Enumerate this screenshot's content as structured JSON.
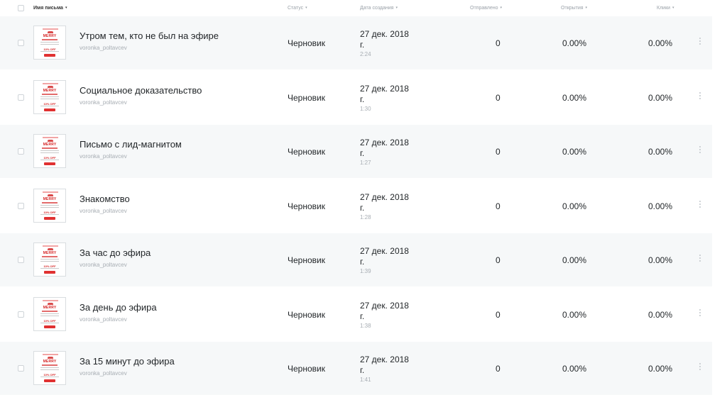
{
  "header": {
    "name": "Имя письма",
    "status": "Статус",
    "created": "Дата создания",
    "sent": "Отправлено",
    "opens": "Открытия",
    "clicks": "Клики"
  },
  "thumbnail": {
    "title": "MERRY",
    "offer": "10% OFF"
  },
  "rows": [
    {
      "name": "Утром тем, кто не был на эфире",
      "sender": "voronka_poltavcev",
      "status": "Черновик",
      "date_line1": "27 дек. 2018",
      "date_line2": "г.",
      "time": "2:24",
      "sent": "0",
      "opens": "0.00%",
      "clicks": "0.00%"
    },
    {
      "name": "Социальное доказательство",
      "sender": "voronka_poltavcev",
      "status": "Черновик",
      "date_line1": "27 дек. 2018",
      "date_line2": "г.",
      "time": "1:30",
      "sent": "0",
      "opens": "0.00%",
      "clicks": "0.00%"
    },
    {
      "name": "Письмо с лид-магнитом",
      "sender": "voronka_poltavcev",
      "status": "Черновик",
      "date_line1": "27 дек. 2018",
      "date_line2": "г.",
      "time": "1:27",
      "sent": "0",
      "opens": "0.00%",
      "clicks": "0.00%"
    },
    {
      "name": "Знакомство",
      "sender": "voronka_poltavcev",
      "status": "Черновик",
      "date_line1": "27 дек. 2018",
      "date_line2": "г.",
      "time": "1:28",
      "sent": "0",
      "opens": "0.00%",
      "clicks": "0.00%"
    },
    {
      "name": "За час до эфира",
      "sender": "voronka_poltavcev",
      "status": "Черновик",
      "date_line1": "27 дек. 2018",
      "date_line2": "г.",
      "time": "1:39",
      "sent": "0",
      "opens": "0.00%",
      "clicks": "0.00%"
    },
    {
      "name": "За день до эфира",
      "sender": "voronka_poltavcev",
      "status": "Черновик",
      "date_line1": "27 дек. 2018",
      "date_line2": "г.",
      "time": "1:38",
      "sent": "0",
      "opens": "0.00%",
      "clicks": "0.00%"
    },
    {
      "name": "За 15 минут до эфира",
      "sender": "voronka_poltavcev",
      "status": "Черновик",
      "date_line1": "27 дек. 2018",
      "date_line2": "г.",
      "time": "1:41",
      "sent": "0",
      "opens": "0.00%",
      "clicks": "0.00%"
    }
  ]
}
